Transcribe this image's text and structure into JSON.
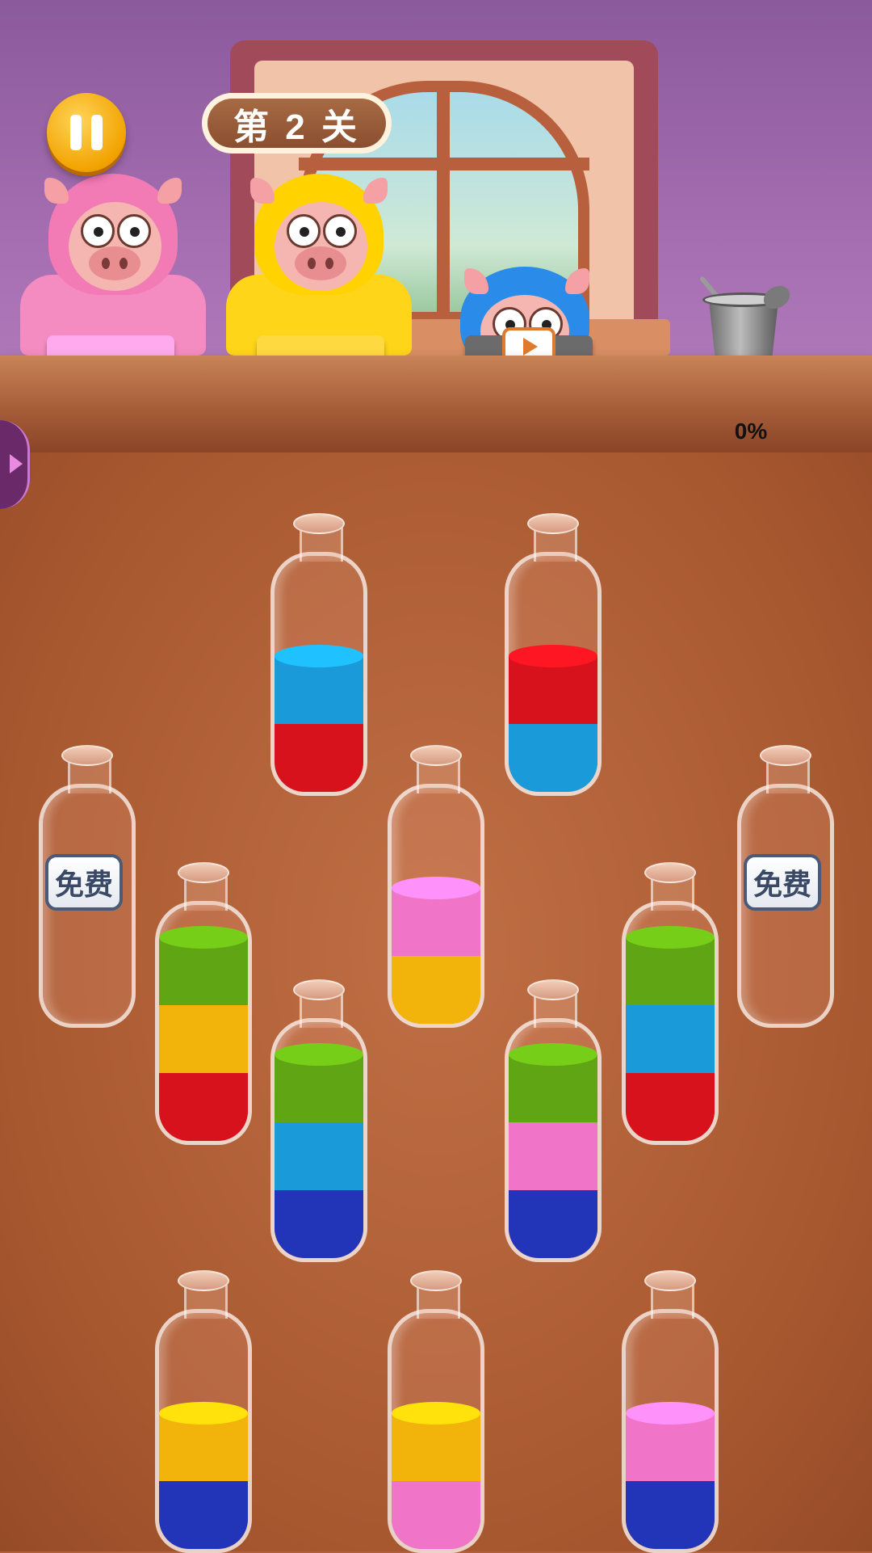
{
  "game": {
    "level_label": "第 2 关",
    "progress_percent": "0%",
    "free_label": "免费"
  },
  "icons": {
    "pause": "pause-icon",
    "video": "video-play-icon",
    "cup": "drink-cup-icon",
    "side_tab": "chevron-right-icon"
  },
  "colors": {
    "red": "#d8121c",
    "blue": "#1a9ad8",
    "green": "#5fa514",
    "yellow": "#f2b40a",
    "pink": "#f074c8",
    "navy": "#2234b8"
  },
  "customers": [
    {
      "color": "pink",
      "box_color": "#f27ae0",
      "status": "waiting"
    },
    {
      "color": "yellow",
      "box_color": "#ffcc00",
      "status": "waiting"
    },
    {
      "color": "blue",
      "box_color": "#3a3a3a",
      "status": "locked-video"
    }
  ],
  "bottles": [
    {
      "id": 1,
      "layers": [
        "red",
        "blue"
      ],
      "free": false
    },
    {
      "id": 2,
      "layers": [
        "blue",
        "red"
      ],
      "free": false
    },
    {
      "id": 3,
      "layers": [],
      "free": true
    },
    {
      "id": 4,
      "layers": [
        "yellow",
        "pink"
      ],
      "free": false
    },
    {
      "id": 5,
      "layers": [],
      "free": true
    },
    {
      "id": 6,
      "layers": [
        "red",
        "yellow",
        "green"
      ],
      "free": false
    },
    {
      "id": 7,
      "layers": [
        "red",
        "blue",
        "green"
      ],
      "free": false
    },
    {
      "id": 8,
      "layers": [
        "navy",
        "blue",
        "green"
      ],
      "free": false
    },
    {
      "id": 9,
      "layers": [
        "navy",
        "pink",
        "green"
      ],
      "free": false
    },
    {
      "id": 10,
      "layers": [
        "navy",
        "yellow"
      ],
      "free": false
    },
    {
      "id": 11,
      "layers": [
        "pink",
        "yellow"
      ],
      "free": false
    },
    {
      "id": 12,
      "layers": [
        "navy",
        "pink"
      ],
      "free": false
    }
  ]
}
